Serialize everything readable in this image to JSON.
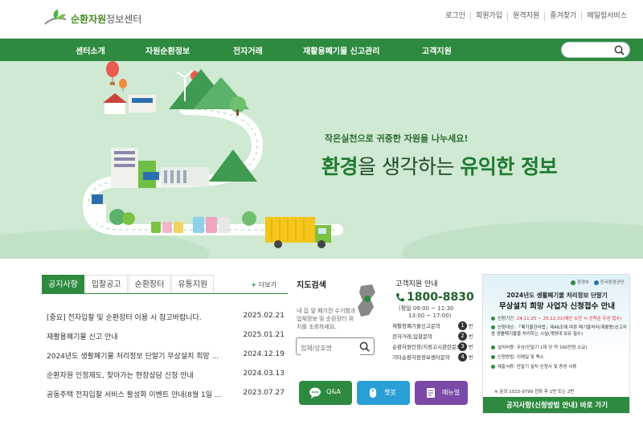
{
  "header": {
    "logo_main": "순환자원",
    "logo_sub": "정보센터",
    "util_links": [
      "로그인",
      "회원가입",
      "원격지원",
      "즐겨찾기",
      "메일링서비스"
    ]
  },
  "gnb": {
    "items": [
      "센터소개",
      "자원순환정보",
      "전자거래",
      "재활용폐기물 신고관리",
      "고객지원"
    ],
    "search_placeholder": ""
  },
  "hero": {
    "subtitle": "작은실천으로 귀중한 자원을 나누세요!",
    "title_part1": "환경",
    "title_part2": "을 생각하는 ",
    "title_part3": "유익한 정보"
  },
  "notice": {
    "tabs": [
      "공지사항",
      "입찰공고",
      "순환장터",
      "유통지원"
    ],
    "more_label": "더보기",
    "items": [
      {
        "title": "[중요] 전자입찰 및 순환장터 이용 시 참고바랍니다.",
        "date": "2025.02.21"
      },
      {
        "title": "재활용폐기물 신고 안내",
        "date": "2025.01.21"
      },
      {
        "title": "2024년도 생활폐기물 처리정보 단말기 무상설치 희망 ...",
        "date": "2024.12.19"
      },
      {
        "title": "순환자원 인정제도, 찾아가는 현장상담 신청 안내",
        "date": "2024.03.13"
      },
      {
        "title": "공동주택 전자입찰 서비스 활성화 이벤트 안내(8월 1일 ...",
        "date": "2023.07.27"
      }
    ]
  },
  "map_search": {
    "title": "지도검색",
    "desc": "내 집 앞 폐기전 수거함과 업체정보 및 순환장터 위치를 조회하세요.",
    "placeholder": "업체/상호명"
  },
  "customer": {
    "title": "고객지원 안내",
    "phone": "1800-8830",
    "hours_line1": "(평일 09:00 ~ 11:30",
    "hours_line2": "13:00 ~ 17:00)",
    "lines": [
      {
        "label": "재활용폐기물신고문의",
        "num": "1",
        "suffix": "번"
      },
      {
        "label": "전자거래,입찰문의",
        "num": "2",
        "suffix": "번"
      },
      {
        "label": "순환자원인정/지정고시관련문의",
        "num": "3",
        "suffix": "번"
      },
      {
        "label": "기타순환자원정보센터문의",
        "num": "4",
        "suffix": "번"
      }
    ]
  },
  "quick": {
    "qa": "Q&A",
    "chatbot": "챗봇",
    "manual": "매뉴얼"
  },
  "popup": {
    "logo1": "환경부",
    "logo2": "한국환경공단",
    "title1": "2024년도 생활폐기물 처리정보 단말기",
    "title2": "무상설치 희망 사업자 신청접수 안내",
    "items": [
      {
        "label": "신청기간",
        "text": ": 24.11.25 ~ 25.12.31(예산 소진 시 선착순 우선 접수)"
      },
      {
        "label": "신청대상",
        "text": ": 「폐기물관리법」제46조에 따른 폐기물처리(재활용)신고자 중 생활폐기물을 처리하는 시설(계량대 보유 필수)"
      },
      {
        "label": "설치비용",
        "text": ": 무상(단말기 1대 당 약 160만원 소요)"
      },
      {
        "label": "신청방법",
        "text": ": 이메일 및 팩스"
      },
      {
        "label": "제출서류",
        "text": ": 단말기 설치 신청서 및 증빙 서류"
      }
    ],
    "contact": "※ 문의 1522-9799 전화 후 1번 또는 2번",
    "footer": "공지사항(신청방법 안내) 바로 가기"
  },
  "colors": {
    "brand_green": "#2d8a3e",
    "hero_bg": "#cfe9d3"
  }
}
